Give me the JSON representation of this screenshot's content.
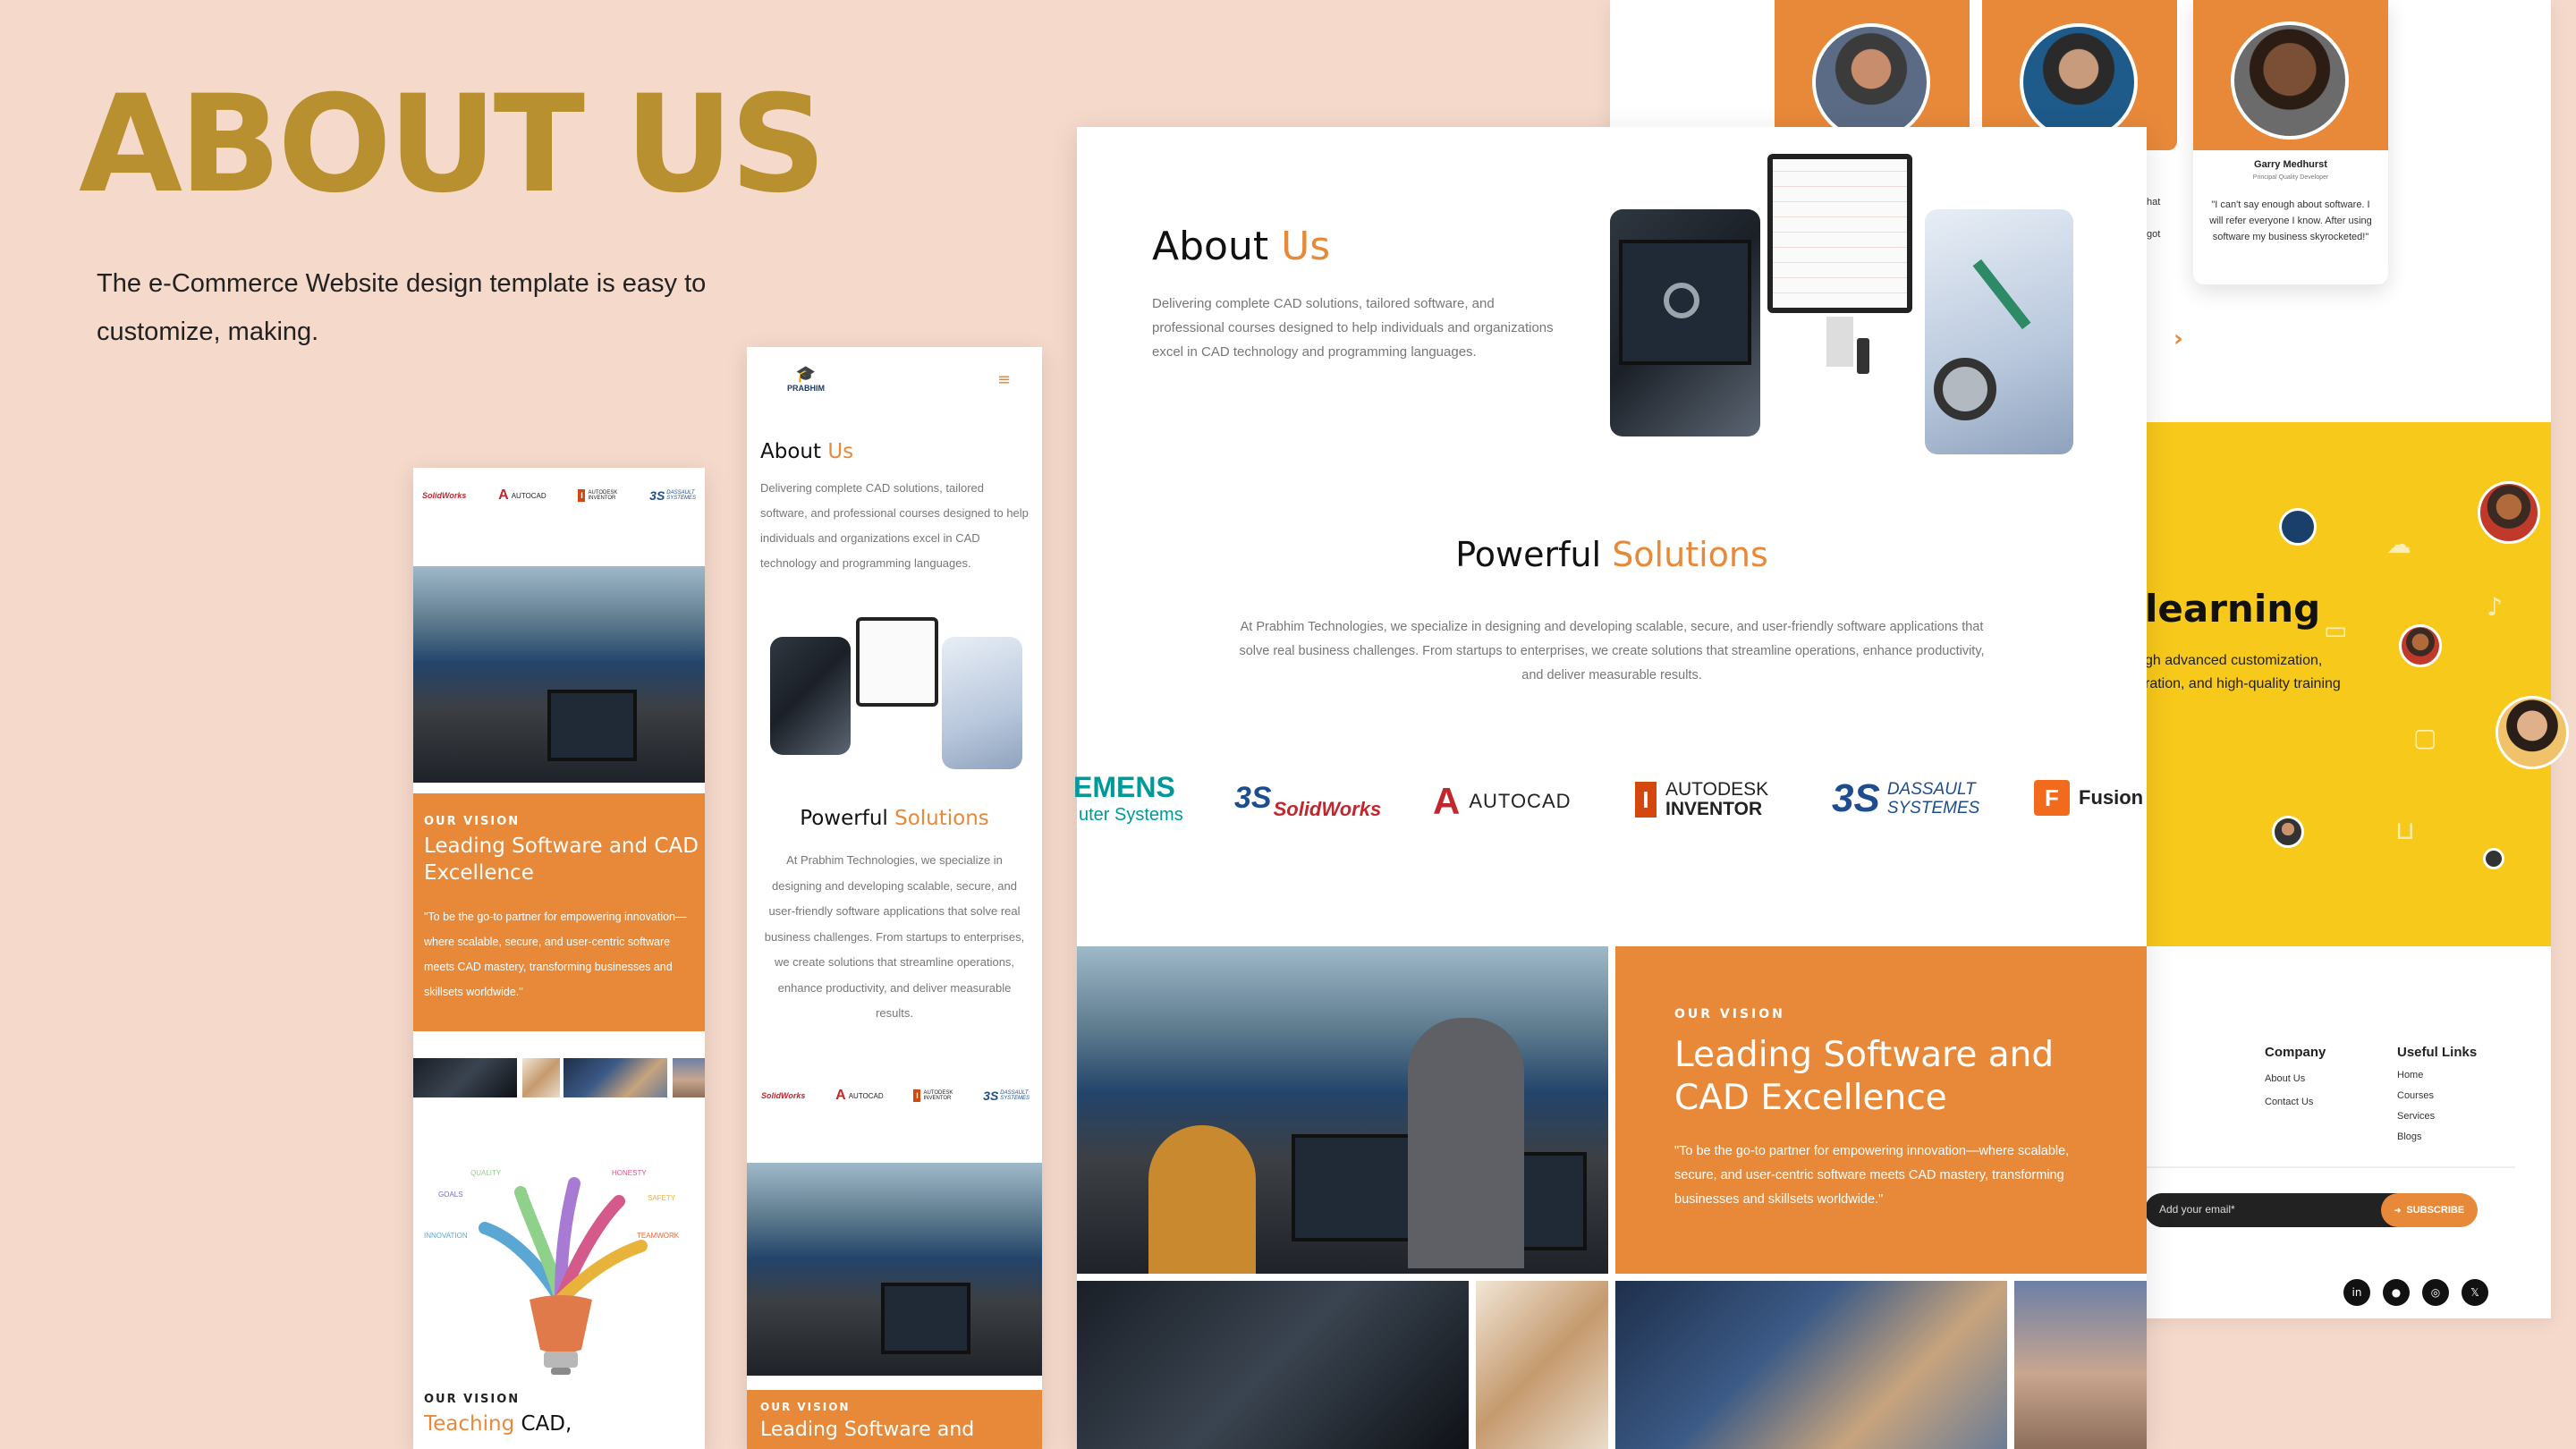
{
  "hero": {
    "title": "ABOUT US",
    "subtitle": "The e-Commerce Website design template is easy to customize, making."
  },
  "colors": {
    "background": "#f5d9cb",
    "accent": "#e8893a",
    "gold": "#b8902f",
    "yellow": "#f7c91b"
  },
  "testimonial": {
    "name": "Garry Medhurst",
    "role": "Principal Quality Developer",
    "quote": "\"I can't say enough about software. I will refer everyone I know. After using software my business skyrocketed!\"",
    "partial_left_1": "hat",
    "partial_left_2": "got",
    "next_icon": "chevron-right-icon"
  },
  "learning": {
    "title_partial": "learning",
    "line1": "gh advanced customization,",
    "line2": "ration, and high-quality training"
  },
  "footer": {
    "company_heading": "Company",
    "company_links": [
      "About Us",
      "Contact Us"
    ],
    "useful_heading": "Useful Links",
    "useful_links": [
      "Home",
      "Courses",
      "Services",
      "Blogs"
    ],
    "email_placeholder": "Add your email*",
    "subscribe_label": "SUBSCRIBE",
    "social": [
      {
        "icon": "linkedin-icon",
        "glyph": "in"
      },
      {
        "icon": "github-icon",
        "glyph": "●"
      },
      {
        "icon": "instagram-icon",
        "glyph": "◎"
      },
      {
        "icon": "x-icon",
        "glyph": "𝕏"
      }
    ]
  },
  "desktop": {
    "about_title_1": "About ",
    "about_title_2": "Us",
    "about_text": "Delivering complete CAD solutions, tailored software, and professional courses designed to help individuals and organizations excel in CAD technology and programming languages.",
    "solutions_title_1": "Powerful ",
    "solutions_title_2": "Solutions",
    "solutions_text": "At Prabhim Technologies, we specialize in designing and developing scalable, secure, and user-friendly software applications that solve real business challenges. From startups to enterprises, we create solutions that streamline operations, enhance productivity, and deliver measurable results.",
    "logos": {
      "siemens_1": "EMENS",
      "siemens_2": "uter Systems",
      "solidworks": "SolidWorks",
      "autocad": "AUTOCAD",
      "autodesk": "AUTODESK",
      "inventor": "INVENTOR",
      "dassault_1": "DASSAULT",
      "dassault_2": "SYSTEMES",
      "fusion": "Fusion"
    },
    "vision_small": "OUR VISION",
    "vision_title": "Leading Software and CAD Excellence",
    "vision_quote": "\"To be the go-to partner for empowering innovation—where scalable, secure, and user-centric software meets CAD mastery, transforming businesses and skillsets worldwide.\""
  },
  "tablet": {
    "brand": "PRABHIM",
    "menu_icon": "hamburger-menu-icon",
    "about_title_1": "About ",
    "about_title_2": "Us",
    "about_text": "Delivering complete CAD solutions, tailored software, and professional courses designed to help individuals and organizations excel in CAD technology and programming languages.",
    "solutions_title_1": "Powerful ",
    "solutions_title_2": "Solutions",
    "solutions_text": "At Prabhim Technologies, we specialize in designing and developing scalable, secure, and user-friendly software applications that solve real business challenges. From startups to enterprises, we create solutions that streamline operations, enhance productivity, and deliver measurable results.",
    "vision_small": "OUR VISION",
    "vision_title_partial": "Leading Software and"
  },
  "phone": {
    "vision_small": "OUR VISION",
    "vision_title": "Leading Software and CAD Excellence",
    "vision_quote": "\"To be the go-to partner for empowering innovation—where scalable, secure, and user-centric software meets CAD mastery, transforming businesses and skillsets worldwide.\"",
    "values": [
      "QUALITY",
      "HONESTY",
      "GOALS",
      "SAFETY",
      "INNOVATION",
      "TEAMWORK"
    ],
    "vision2_small": "OUR VISION",
    "teaching_1": "Teaching ",
    "teaching_2": "CAD,"
  },
  "logos_small": {
    "solidworks": "SolidWorks",
    "autocad": "AUTOCAD",
    "autodesk": "AUTODESK",
    "inventor": "INVENTOR",
    "dassault_1": "DASSAULT",
    "dassault_2": "SYSTEMES"
  }
}
